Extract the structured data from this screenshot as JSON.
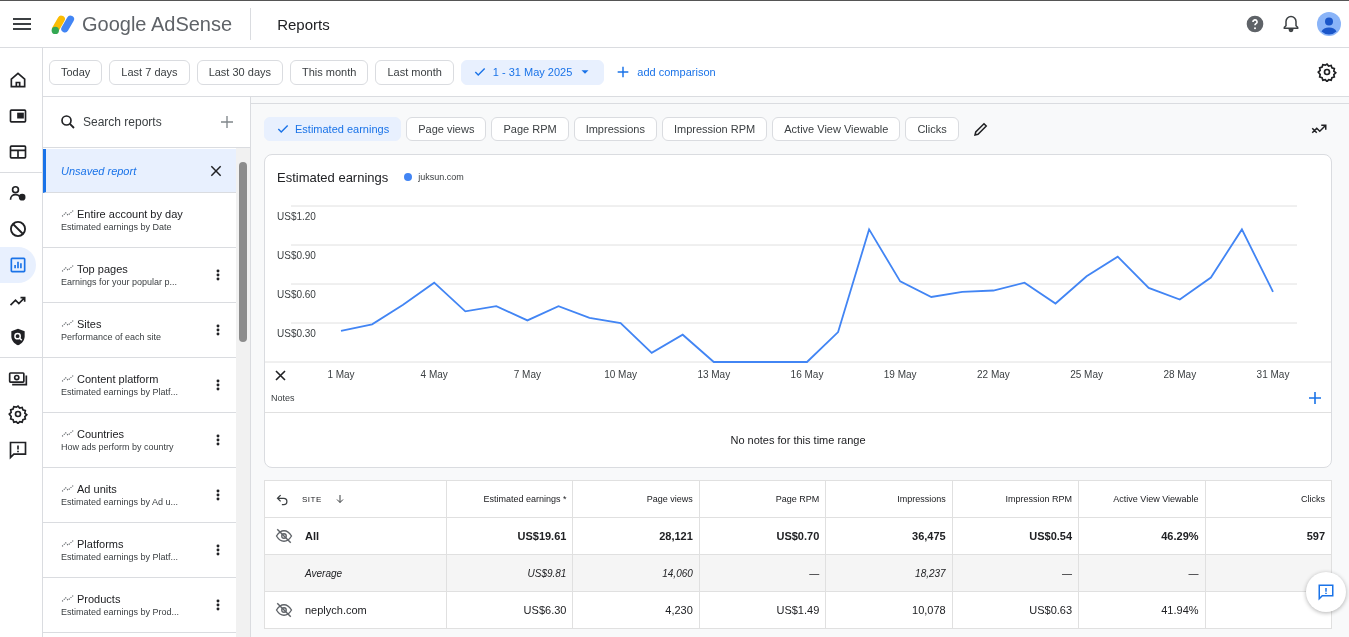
{
  "app": {
    "product": "Google AdSense",
    "page_title": "Reports"
  },
  "rail": [
    {
      "selected": false
    },
    {
      "selected": false
    },
    {
      "selected": false
    },
    {
      "selected": false
    },
    {
      "selected": false
    },
    {
      "selected": true
    },
    {
      "selected": false
    },
    {
      "selected": false
    },
    {
      "selected": false
    },
    {
      "selected": false
    },
    {
      "selected": false
    }
  ],
  "date_presets": [
    {
      "label": "Today",
      "selected": false
    },
    {
      "label": "Last 7 days",
      "selected": false
    },
    {
      "label": "Last 30 days",
      "selected": false
    },
    {
      "label": "This month",
      "selected": false
    },
    {
      "label": "Last month",
      "selected": false
    }
  ],
  "date_range": {
    "label": "1 - 31 May 2025",
    "selected": true
  },
  "add_comparison": "add comparison",
  "reports_panel": {
    "search": {
      "placeholder": "Search reports"
    },
    "current": "Unsaved report",
    "items": [
      {
        "name": "Entire account by day",
        "description": "Estimated earnings by Date",
        "more_button": false
      },
      {
        "name": "Top pages",
        "description": "Earnings for your popular p...",
        "more_button": true
      },
      {
        "name": "Sites",
        "description": "Performance of each site",
        "more_button": true
      },
      {
        "name": "Content platform",
        "description": "Estimated earnings by Platf...",
        "more_button": true
      },
      {
        "name": "Countries",
        "description": "How ads perform by country",
        "more_button": true
      },
      {
        "name": "Ad units",
        "description": "Estimated earnings by Ad u...",
        "more_button": true
      },
      {
        "name": "Platforms",
        "description": "Estimated earnings by Platf...",
        "more_button": true
      },
      {
        "name": "Products",
        "description": "Estimated earnings by Prod...",
        "more_button": true
      }
    ]
  },
  "metrics": [
    {
      "label": "Estimated earnings",
      "selected": true
    },
    {
      "label": "Page views",
      "selected": false
    },
    {
      "label": "Page RPM",
      "selected": false
    },
    {
      "label": "Impressions",
      "selected": false
    },
    {
      "label": "Impression RPM",
      "selected": false
    },
    {
      "label": "Active View Viewable",
      "selected": false
    },
    {
      "label": "Clicks",
      "selected": false
    }
  ],
  "chart_card": {
    "title": "Estimated earnings",
    "y_axis_labels": [
      "US$1.20",
      "US$0.90",
      "US$0.60",
      "US$0.30"
    ],
    "notes_label": "Notes",
    "notes_empty": "No notes for this time range",
    "legend": [
      {
        "name": "juksun.com",
        "color": "#4285f4"
      }
    ],
    "x_axis_labels": [
      "1 May",
      "4 May",
      "7 May",
      "10 May",
      "13 May",
      "16 May",
      "19 May",
      "22 May",
      "25 May",
      "28 May",
      "31 May"
    ]
  },
  "table": {
    "columns": [
      "SITE",
      "Estimated earnings *",
      "Page views",
      "Page RPM",
      "Impressions",
      "Impression RPM",
      "Active View Viewable",
      "Clicks"
    ],
    "rows": [
      {
        "kind": "total",
        "cells": [
          "All",
          "US$19.61",
          "28,121",
          "US$0.70",
          "36,475",
          "US$0.54",
          "46.29%",
          "597"
        ]
      },
      {
        "kind": "average",
        "cells": [
          "Average",
          "US$9.81",
          "14,060",
          "—",
          "18,237",
          "—",
          "—"
        ]
      },
      {
        "kind": "site",
        "cells": [
          "neplych.com",
          "US$6.30",
          "4,230",
          "US$1.49",
          "10,078",
          "US$0.63",
          "41.94%"
        ]
      }
    ]
  }
}
